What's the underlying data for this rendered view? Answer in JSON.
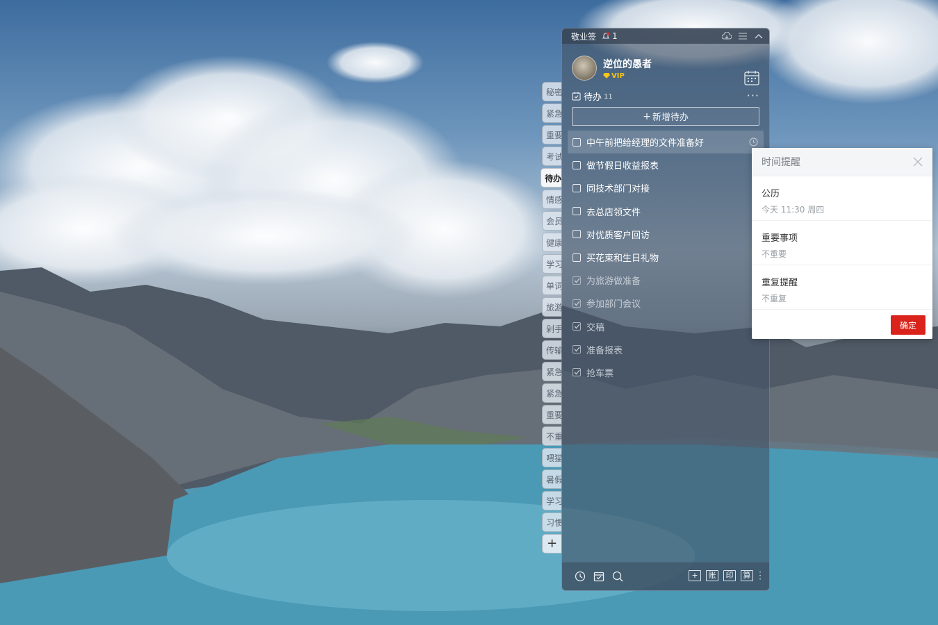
{
  "app": {
    "title": "敬业签",
    "notification_count": "1"
  },
  "user": {
    "name": "逆位的愚者",
    "badge": "VIP"
  },
  "side_tabs": [
    {
      "label": "秘密"
    },
    {
      "label": "紧急"
    },
    {
      "label": "重要"
    },
    {
      "label": "考试"
    },
    {
      "label": "待办",
      "active": true
    },
    {
      "label": "情感"
    },
    {
      "label": "会员"
    },
    {
      "label": "健康"
    },
    {
      "label": "学习"
    },
    {
      "label": "单词"
    },
    {
      "label": "旅游"
    },
    {
      "label": "剁手"
    },
    {
      "label": "传输"
    },
    {
      "label": "紧急"
    },
    {
      "label": "紧急"
    },
    {
      "label": "重要"
    },
    {
      "label": "不重"
    },
    {
      "label": "喂猫"
    },
    {
      "label": "暑假"
    },
    {
      "label": "学习"
    },
    {
      "label": "习惯"
    }
  ],
  "side_add_label": "+",
  "section": {
    "title": "待办",
    "count": "11"
  },
  "add_todo_label": "新增待办",
  "todos": [
    {
      "text": "中午前把给经理的文件准备好",
      "done": false
    },
    {
      "text": "做节假日收益报表",
      "done": false
    },
    {
      "text": "同技术部门对接",
      "done": false
    },
    {
      "text": "去总店领文件",
      "done": false
    },
    {
      "text": "对优质客户回访",
      "done": false
    },
    {
      "text": "买花束和生日礼物",
      "done": false
    },
    {
      "text": "为旅游做准备",
      "done": true
    },
    {
      "text": "参加部门会议",
      "done": true
    },
    {
      "text": "交稿",
      "done": true
    },
    {
      "text": "准备报表",
      "done": true
    },
    {
      "text": "抢车票",
      "done": true
    }
  ],
  "bottom_buttons": [
    "账",
    "印",
    "算"
  ],
  "popup": {
    "title": "时间提醒",
    "rows": [
      {
        "label": "公历",
        "value": "今天 11:30 周四"
      },
      {
        "label": "重要事项",
        "value": "不重要"
      },
      {
        "label": "重复提醒",
        "value": "不重复"
      }
    ],
    "confirm_label": "确定"
  },
  "colors": {
    "accent_red": "#d9231b",
    "panel_bg": "#445468"
  }
}
